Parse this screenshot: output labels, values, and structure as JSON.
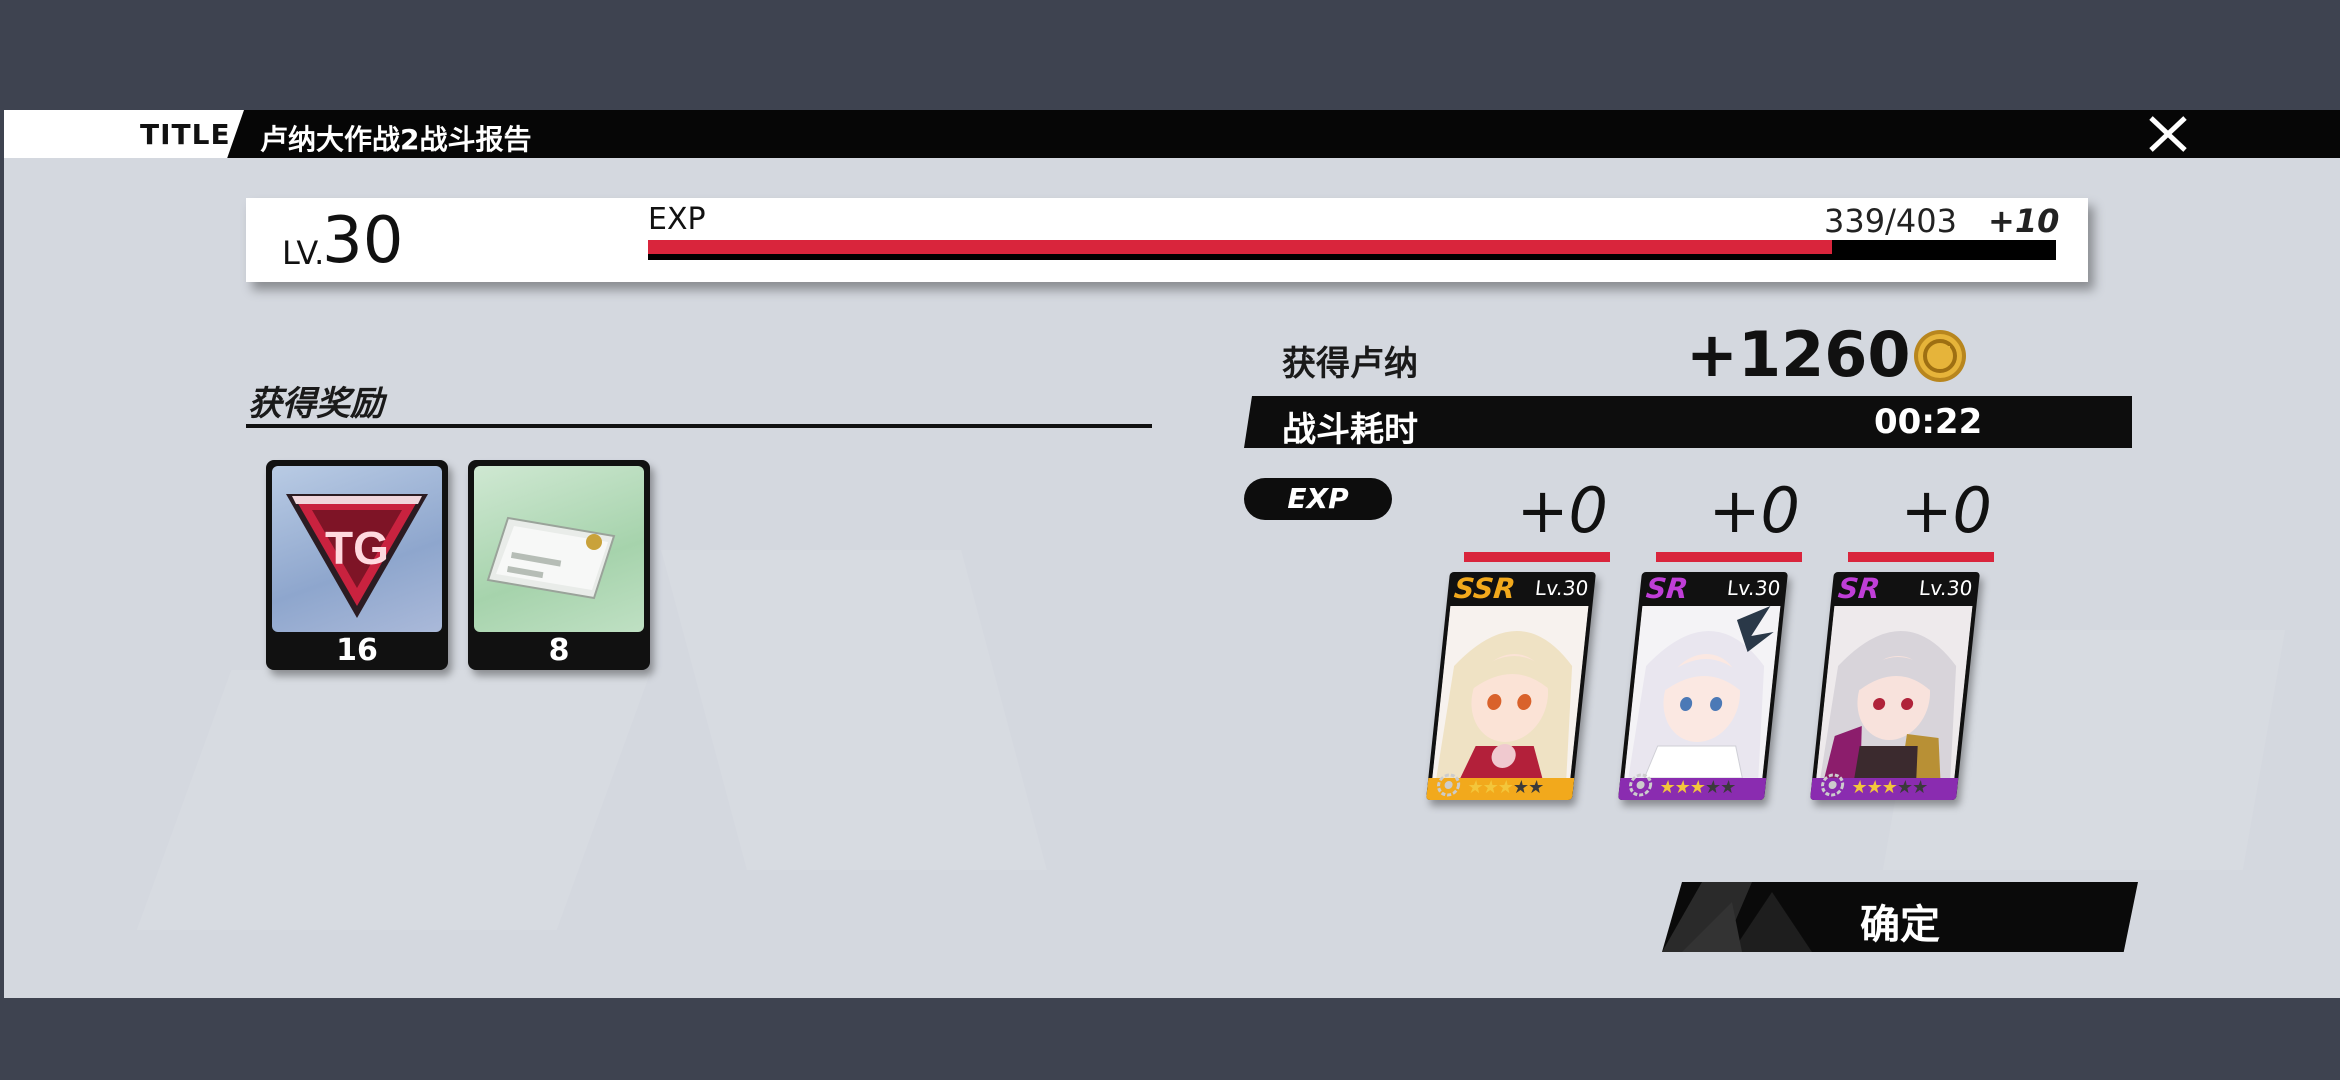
{
  "titlebar": {
    "tag": "TITLE",
    "title": "卢纳大作战2战斗报告",
    "close_icon": "close-icon"
  },
  "level": {
    "prefix": "LV.",
    "value": "30",
    "exp_label": "EXP",
    "exp_count": "339/403",
    "exp_gain": "+10",
    "exp_current": 339,
    "exp_max": 403,
    "fill_color": "#d9253c"
  },
  "rewards": {
    "title": "获得奖励",
    "items": [
      {
        "icon": "emblem-icon",
        "count": "16"
      },
      {
        "icon": "ticket-card-icon",
        "count": "8"
      }
    ]
  },
  "luna": {
    "label": "获得卢纳",
    "value": "+1260",
    "icon": "coin-icon"
  },
  "battle": {
    "label": "战斗耗时",
    "time": "00:22"
  },
  "exp_pill": "EXP",
  "characters": [
    {
      "gain": "+0",
      "rarity": "SSR",
      "rarity_color": "#f2a91c",
      "level": "Lv.30",
      "stars": 3,
      "max_stars": 5,
      "footer_color": "#f2a91c",
      "hair": "#efe2c4"
    },
    {
      "gain": "+0",
      "rarity": "SR",
      "rarity_color": "#c03ed8",
      "level": "Lv.30",
      "stars": 3,
      "max_stars": 5,
      "footer_color": "#8a2cb0",
      "hair": "#e9e6ef"
    },
    {
      "gain": "+0",
      "rarity": "SR",
      "rarity_color": "#c03ed8",
      "level": "Lv.30",
      "stars": 3,
      "max_stars": 5,
      "footer_color": "#8a2cb0",
      "hair": "#d8d4da"
    }
  ],
  "confirm_label": "确定",
  "accent_color": "#d9253c"
}
